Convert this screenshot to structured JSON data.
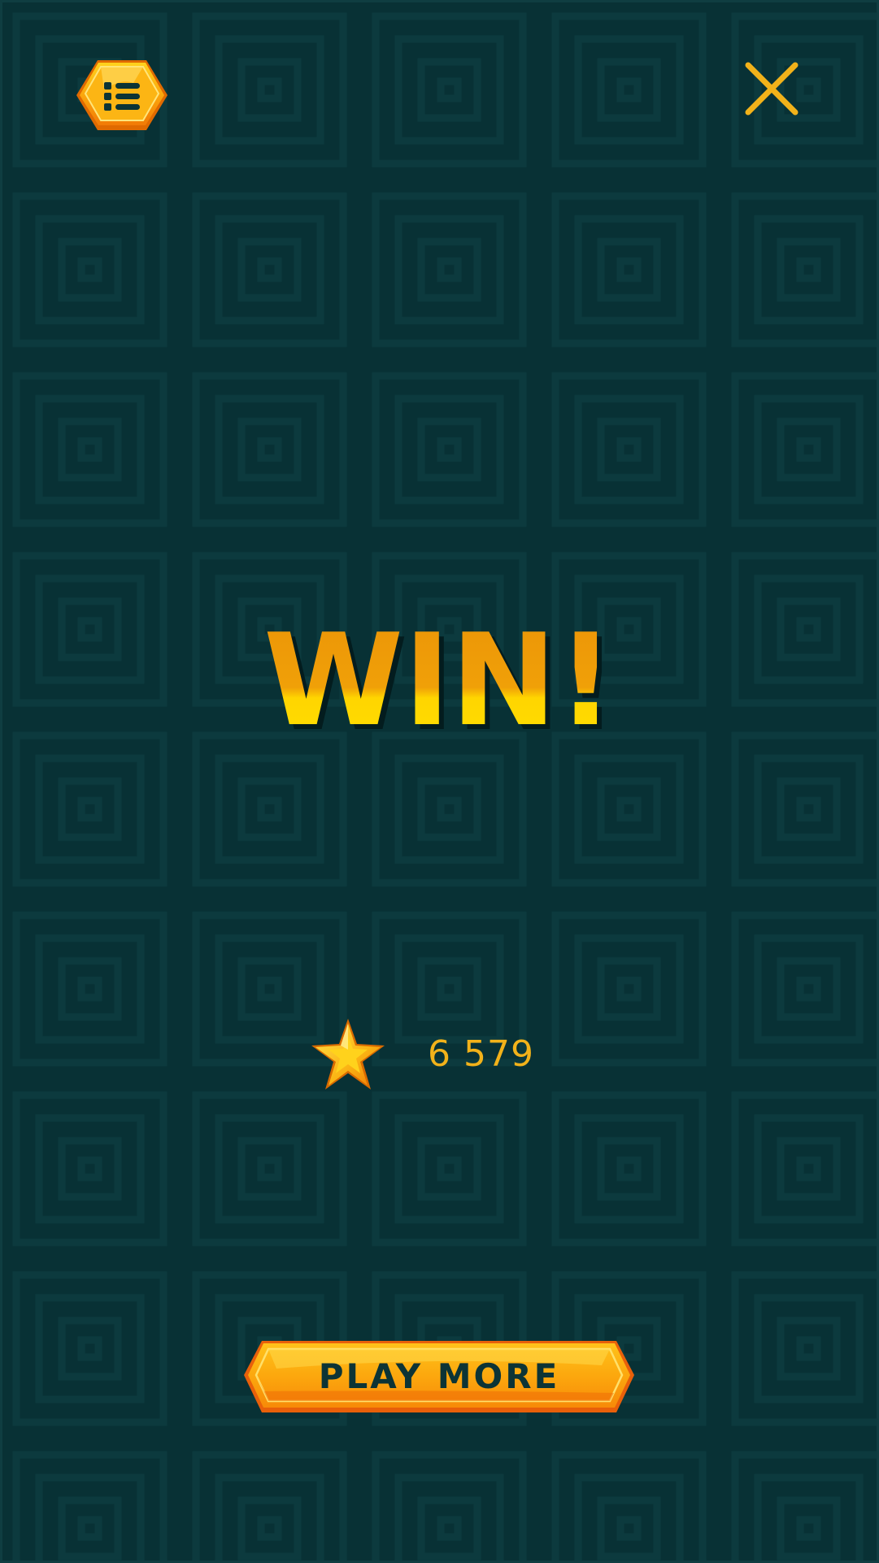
{
  "title": "WIN!",
  "score": {
    "value": "6 579",
    "icon": "star-icon"
  },
  "buttons": {
    "menu_icon": "list-icon",
    "close_icon": "close-icon",
    "play_more_label": "PLAY MORE"
  },
  "colors": {
    "background": "#083135",
    "pattern_line": "#0d3a3e",
    "accent_gold": "#f2b21a",
    "title_orange": "#eb9407",
    "title_yellow": "#ffd500",
    "button_orange": "#f99a0a",
    "button_text": "#0c3436"
  }
}
